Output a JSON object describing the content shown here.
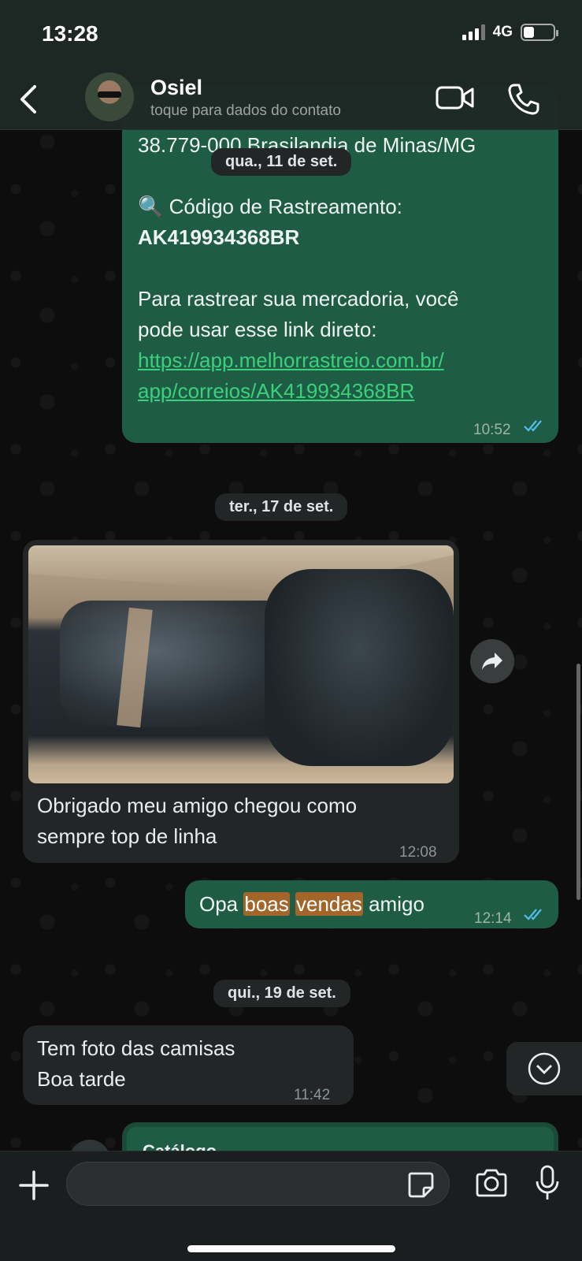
{
  "status_bar": {
    "time": "13:28",
    "network": "4G",
    "battery_level": 0.35
  },
  "header": {
    "contact_name": "Osiel",
    "contact_subtitle": "toque para dados do contato"
  },
  "messages": {
    "m1": {
      "address_line": "38.779-000 Brasilandia de Minas/MG",
      "tracking_icon": "🔍",
      "tracking_label": "Código de Rastreamento:",
      "tracking_code": "AK419934368BR",
      "text_line1": "Para rastrear sua mercadoria, você",
      "text_line2": "pode usar esse link direto:",
      "link_line1": "https://app.melhorrastreio.com.br/",
      "link_line2": "app/correios/AK419934368BR",
      "time": "10:52"
    },
    "date1": "qua., 11 de set.",
    "date2": "ter., 17 de set.",
    "m2": {
      "text_line1": "Obrigado meu amigo chegou como",
      "text_line2": "sempre top de linha",
      "time": "12:08"
    },
    "m3": {
      "w1": "Opa",
      "w2": "boas",
      "w3": "vendas",
      "w4": "amigo",
      "time": "12:14"
    },
    "date3": "qui., 19 de set.",
    "m4": {
      "text_line1": "Tem foto das camisas",
      "text_line2": "Boa tarde",
      "time": "11:42"
    },
    "m5": {
      "title": "Catálogo"
    }
  },
  "composer": {
    "placeholder": "",
    "value": ""
  },
  "icons": {
    "back": "chevron-left-icon",
    "video": "video-camera-icon",
    "call": "phone-icon",
    "forward": "forward-arrow-icon",
    "scroll_down": "chevron-down-icon",
    "plus": "plus-icon",
    "sticker": "sticker-icon",
    "camera": "camera-icon",
    "mic": "microphone-icon"
  },
  "colors": {
    "outgoing_bubble": "#1f5c45",
    "incoming_bubble": "#232627",
    "link": "#3bd17a",
    "read_ticks": "#53bdeb",
    "highlight": "#a2662a"
  }
}
